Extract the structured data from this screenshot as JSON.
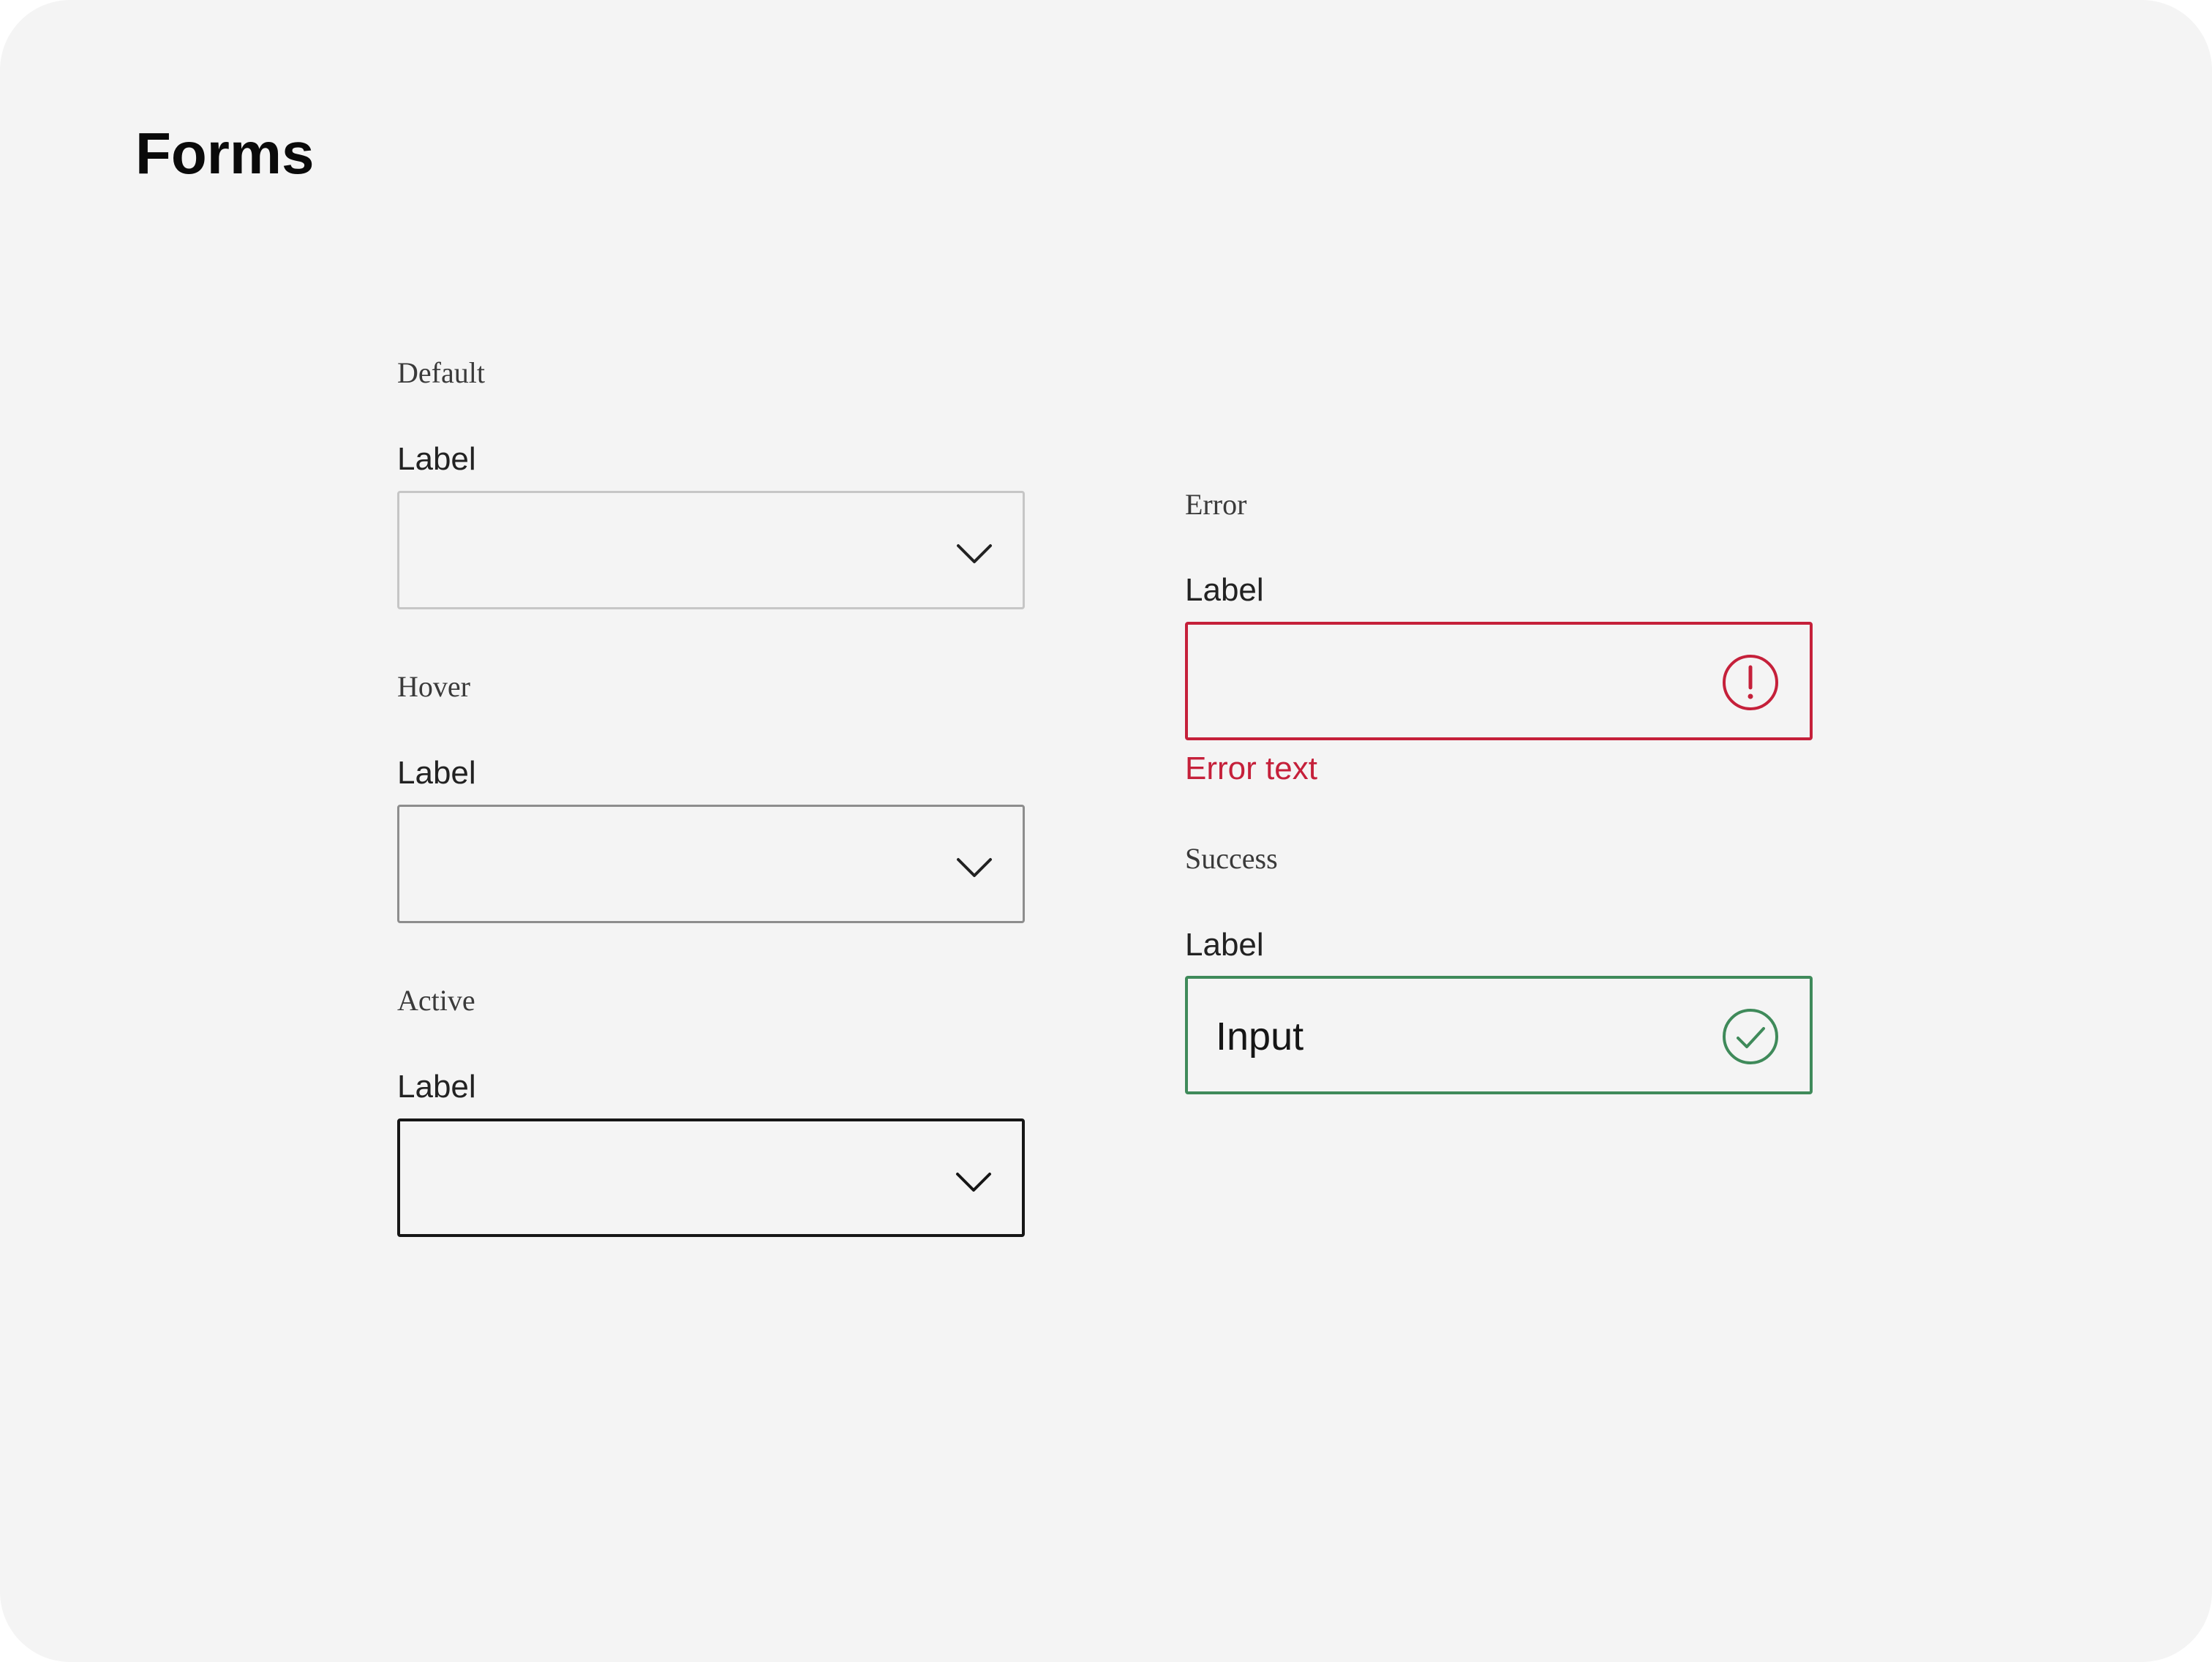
{
  "page": {
    "title": "Forms"
  },
  "colors": {
    "background": "#f4f4f4",
    "default_border": "#c6c6c6",
    "hover_border": "#8d8d8d",
    "active_border": "#161616",
    "error": "#c5203a",
    "success": "#3f8a5a"
  },
  "fields": {
    "default": {
      "state": "Default",
      "label": "Label",
      "icon": "chevron-down-icon"
    },
    "hover": {
      "state": "Hover",
      "label": "Label",
      "icon": "chevron-down-icon"
    },
    "active": {
      "state": "Active",
      "label": "Label",
      "icon": "chevron-down-icon"
    },
    "error": {
      "state": "Error",
      "label": "Label",
      "icon": "error-circle-icon",
      "message": "Error text"
    },
    "success": {
      "state": "Success",
      "label": "Label",
      "value": "Input",
      "icon": "check-circle-icon"
    }
  }
}
